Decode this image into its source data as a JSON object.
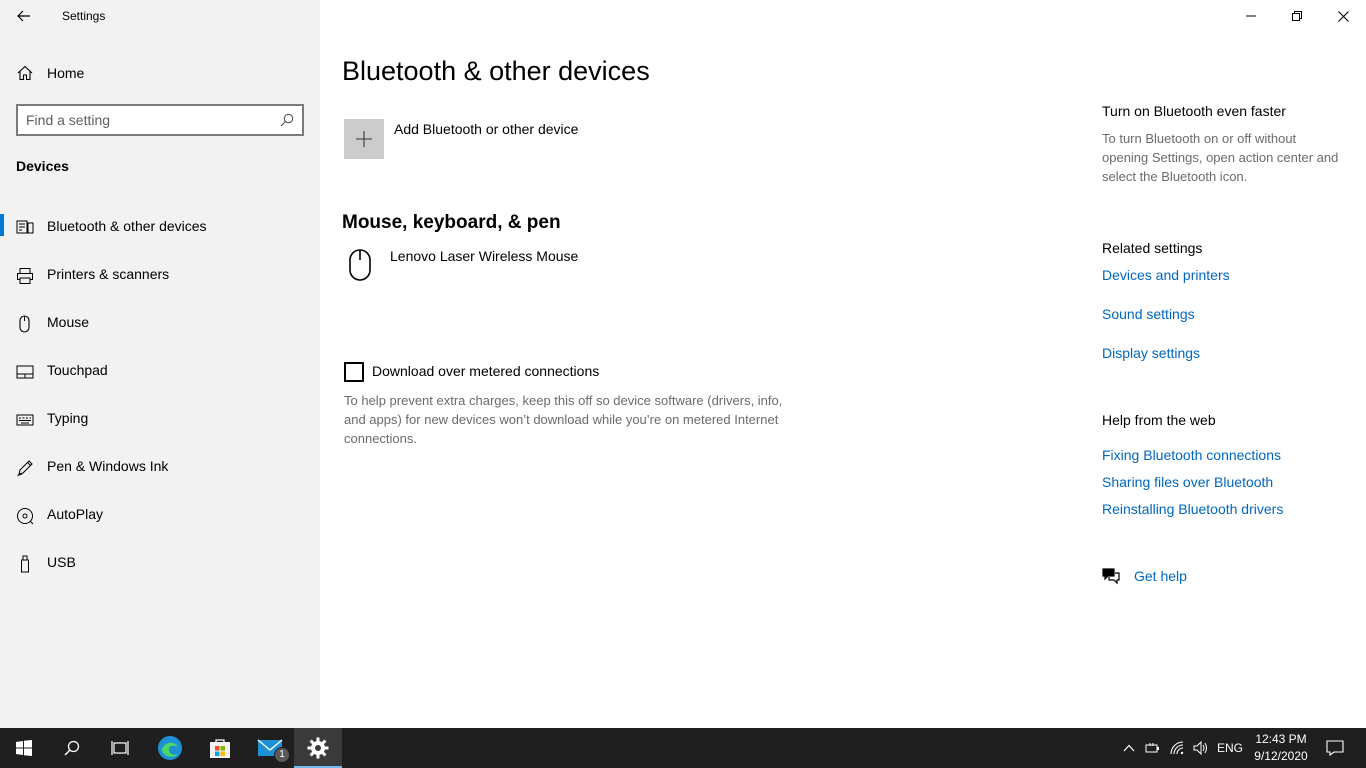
{
  "window": {
    "app_title": "Settings"
  },
  "sidebar": {
    "home_label": "Home",
    "search_placeholder": "Find a setting",
    "section_heading": "Devices",
    "items": [
      {
        "label": "Bluetooth & other devices",
        "icon": "bluetooth-devices-icon",
        "active": true
      },
      {
        "label": "Printers & scanners",
        "icon": "printer-icon",
        "active": false
      },
      {
        "label": "Mouse",
        "icon": "mouse-icon",
        "active": false
      },
      {
        "label": "Touchpad",
        "icon": "touchpad-icon",
        "active": false
      },
      {
        "label": "Typing",
        "icon": "keyboard-icon",
        "active": false
      },
      {
        "label": "Pen & Windows Ink",
        "icon": "pen-icon",
        "active": false
      },
      {
        "label": "AutoPlay",
        "icon": "autoplay-icon",
        "active": false
      },
      {
        "label": "USB",
        "icon": "usb-icon",
        "active": false
      }
    ]
  },
  "main": {
    "title": "Bluetooth & other devices",
    "add_device_label": "Add Bluetooth or other device",
    "mouse_section_heading": "Mouse, keyboard, & pen",
    "devices": [
      {
        "name": "Lenovo Laser Wireless Mouse",
        "icon": "mouse-icon"
      }
    ],
    "metered_checkbox_label": "Download over metered connections",
    "metered_checkbox_checked": false,
    "metered_description": "To help prevent extra charges, keep this off so device software (drivers, info, and apps) for new devices won’t download while you’re on metered Internet connections."
  },
  "right": {
    "tip_heading": "Turn on Bluetooth even faster",
    "tip_text": "To turn Bluetooth on or off without opening Settings, open action center and select the Bluetooth icon.",
    "related_heading": "Related settings",
    "related_links": [
      "Devices and printers",
      "Sound settings",
      "Display settings"
    ],
    "help_heading": "Help from the web",
    "help_links": [
      "Fixing Bluetooth connections",
      "Sharing files over Bluetooth",
      "Reinstalling Bluetooth drivers"
    ],
    "get_help_label": "Get help"
  },
  "taskbar": {
    "mail_badge": "1",
    "language": "ENG",
    "time": "12:43 PM",
    "date": "9/12/2020"
  },
  "colors": {
    "accent": "#0078d7",
    "link": "#0067c0",
    "sidebar_bg": "#f2f2f2",
    "taskbar_bg": "#1f1f1f"
  }
}
